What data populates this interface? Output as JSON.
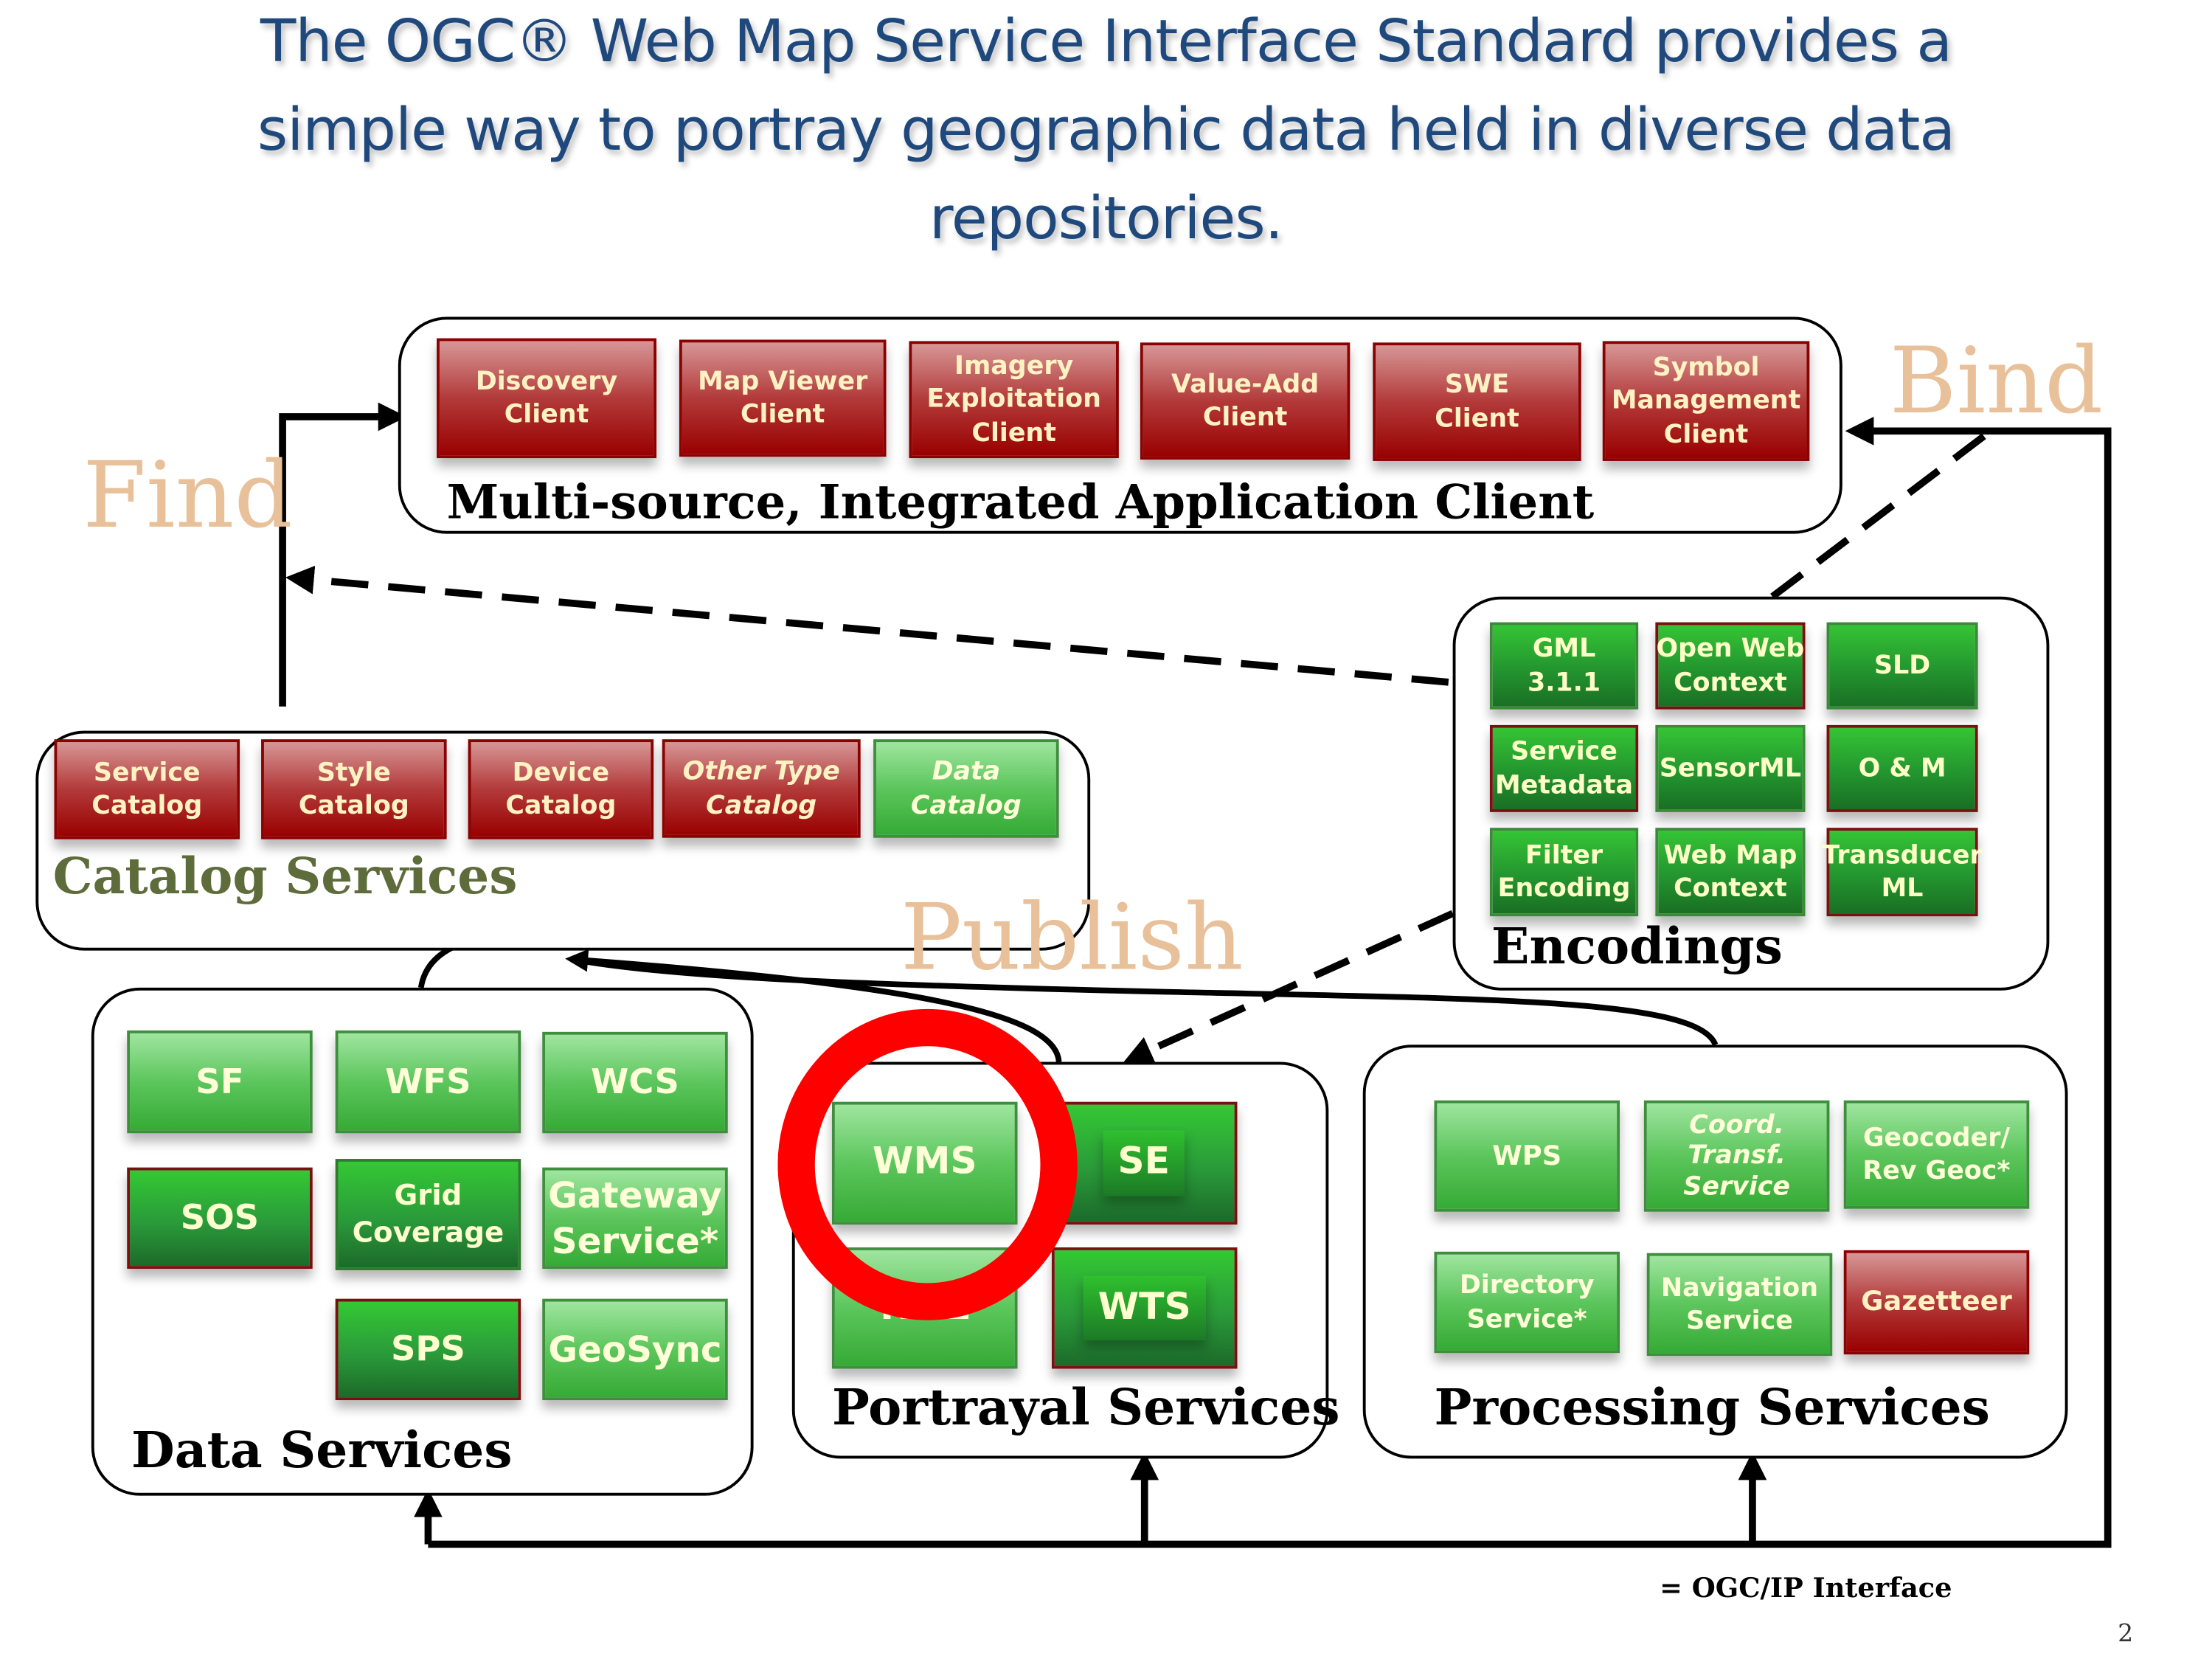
{
  "title": "The OGC® Web Map Service Interface Standard provides a simple way to portray geographic data held in diverse data repositories.",
  "title_lines": [
    "The OGC® Web Map Service Interface Standard provides a",
    "simple way to portray geographic data held in diverse data",
    "repositories."
  ],
  "verbs": {
    "find": "Find",
    "bind": "Bind",
    "publish": "Publish"
  },
  "client_group": {
    "label": "Multi-source, Integrated Application Client",
    "items": [
      {
        "label": "Discovery\nClient",
        "color": "red"
      },
      {
        "label": "Map Viewer\nClient",
        "color": "red"
      },
      {
        "label": "Imagery\nExploitation\nClient",
        "color": "red"
      },
      {
        "label": "Value-Add\nClient",
        "color": "red"
      },
      {
        "label": "SWE\nClient",
        "color": "red"
      },
      {
        "label": "Symbol\nManagement\nClient",
        "color": "red"
      }
    ]
  },
  "catalog_group": {
    "label": "Catalog Services",
    "items": [
      {
        "label": "Service\nCatalog",
        "color": "red"
      },
      {
        "label": "Style\nCatalog",
        "color": "red"
      },
      {
        "label": "Device\nCatalog",
        "color": "red"
      },
      {
        "label": "Other Type\nCatalog",
        "color": "red",
        "italic": true
      },
      {
        "label": "Data\nCatalog",
        "color": "green",
        "italic": true
      }
    ]
  },
  "encodings_group": {
    "label": "Encodings",
    "items": [
      {
        "label": "GML\n3.1.1"
      },
      {
        "label": "Open Web\nContext",
        "red_border": true
      },
      {
        "label": "SLD"
      },
      {
        "label": "Service\nMetadata",
        "red_border": true
      },
      {
        "label": "SensorML"
      },
      {
        "label": "O & M",
        "red_border": true
      },
      {
        "label": "Filter\nEncoding"
      },
      {
        "label": "Web Map\nContext"
      },
      {
        "label": "Transducer\nML",
        "red_border": true
      }
    ]
  },
  "data_group": {
    "label": "Data Services",
    "items": [
      {
        "label": "SF"
      },
      {
        "label": "WFS"
      },
      {
        "label": "WCS"
      },
      {
        "label": "SOS",
        "red_border": true
      },
      {
        "label": "Grid\nCoverage"
      },
      {
        "label": "Gateway\nService*"
      },
      {
        "label": "SPS",
        "red_border": true
      },
      {
        "label": "GeoSync"
      }
    ]
  },
  "portrayal_group": {
    "label": "Portrayal Services",
    "items": [
      {
        "label": "WMS",
        "highlighted": true
      },
      {
        "label": "SE"
      },
      {
        "label": "KML"
      },
      {
        "label": "WTS"
      }
    ]
  },
  "processing_group": {
    "label": "Processing Services",
    "items": [
      {
        "label": "WPS",
        "color": "green"
      },
      {
        "label": "Coord.\nTransf.\nService",
        "color": "green",
        "italic": true
      },
      {
        "label": "Geocoder/\nRev Geoc*",
        "color": "green"
      },
      {
        "label": "Directory\nService*",
        "color": "green"
      },
      {
        "label": "Navigation\nService",
        "color": "green"
      },
      {
        "label": "Gazetteer",
        "color": "red"
      }
    ]
  },
  "highlight": {
    "target": "WMS",
    "color": "#ff0000"
  },
  "legend": "= OGC/IP Interface",
  "page_number": "2",
  "colors": {
    "title": "#1f497d",
    "verb": "#e8c19a",
    "client_red": "#b33a3a",
    "service_green": "#35aa35",
    "highlight_red": "#ff0000"
  }
}
